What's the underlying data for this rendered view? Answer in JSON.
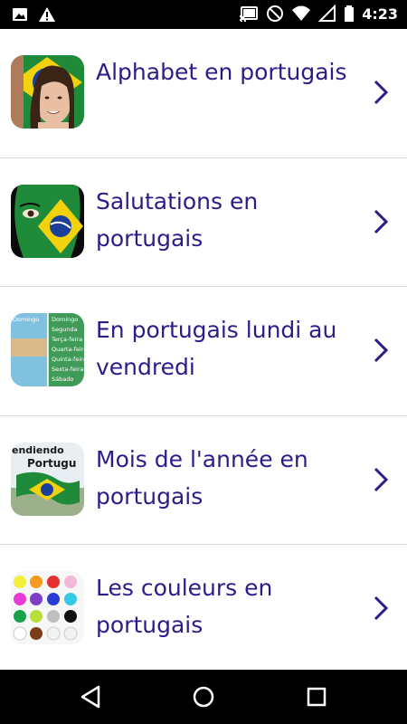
{
  "status_bar": {
    "time": "4:23",
    "left_icons": [
      "image-icon",
      "warning-icon"
    ],
    "right_icons": [
      "cast-icon",
      "do-not-disturb-icon",
      "wifi-icon",
      "signal-icon",
      "battery-icon"
    ]
  },
  "lessons": [
    {
      "label": "Alphabet en portugais",
      "thumb": "woman-brazil-flag-thumbnail"
    },
    {
      "label": "Salutations en portugais",
      "thumb": "face-paint-flag-thumbnail"
    },
    {
      "label": "En portugais lundi au vendredi",
      "thumb": "weekdays-chart-thumbnail",
      "thumb_text": [
        "Domingo",
        "Segunda",
        "Terça-feira",
        "Quarta-feira",
        "Quinta-feira",
        "Sexta-feira",
        "Sábado"
      ]
    },
    {
      "label": "Mois de l'année en portugais",
      "thumb": "aprendiendo-portugues-thumbnail",
      "thumb_text": [
        "endiendo",
        "Portugu"
      ]
    },
    {
      "label": "Les couleurs en portugais",
      "thumb": "color-circles-thumbnail"
    }
  ],
  "nav_bar": {
    "buttons": [
      "back-icon",
      "home-icon",
      "recents-icon"
    ]
  },
  "colors": {
    "label": "#2a1d8a",
    "chevron": "#2a1d8a",
    "divider": "#d7d7d7"
  }
}
